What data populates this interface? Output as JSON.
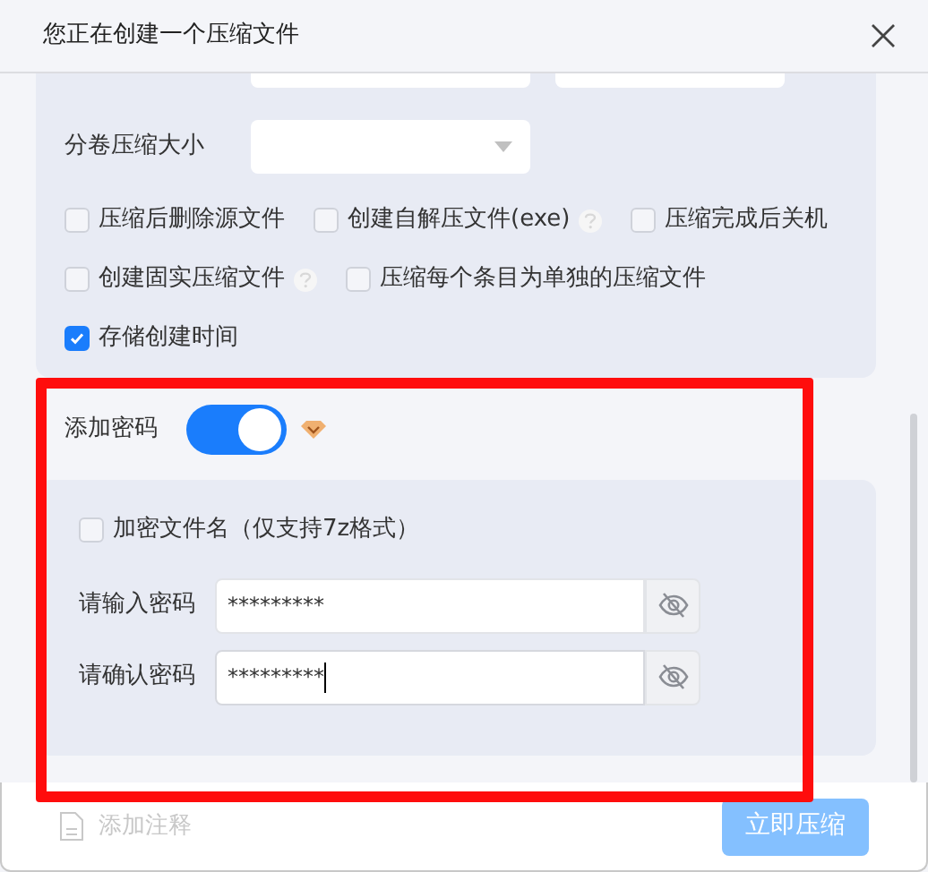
{
  "window": {
    "title": "您正在创建一个压缩文件"
  },
  "split_volume": {
    "label": "分卷压缩大小"
  },
  "option_rows": [
    [
      {
        "label": "压缩后删除源文件",
        "checked": false,
        "help": false
      },
      {
        "label": "创建自解压文件(exe)",
        "checked": false,
        "help": true
      },
      {
        "label": "压缩完成后关机",
        "checked": false,
        "help": false
      }
    ],
    [
      {
        "label": "创建固实压缩文件",
        "checked": false,
        "help": true
      },
      {
        "label": "压缩每个条目为单独的压缩文件",
        "checked": false,
        "help": false
      }
    ],
    [
      {
        "label": "存储创建时间",
        "checked": true,
        "help": false
      }
    ]
  ],
  "password": {
    "label": "添加密码",
    "on": true,
    "encrypt_names": {
      "label": "加密文件名（仅支持7z格式）",
      "checked": false
    },
    "fields": [
      {
        "label": "请输入密码",
        "value": "*********",
        "focused": false
      },
      {
        "label": "请确认密码",
        "value": "*********",
        "focused": true
      }
    ]
  },
  "footer": {
    "comment": {
      "label": "添加注释",
      "disabled": true
    },
    "submit": {
      "label": "立即压缩",
      "disabled": true
    }
  }
}
